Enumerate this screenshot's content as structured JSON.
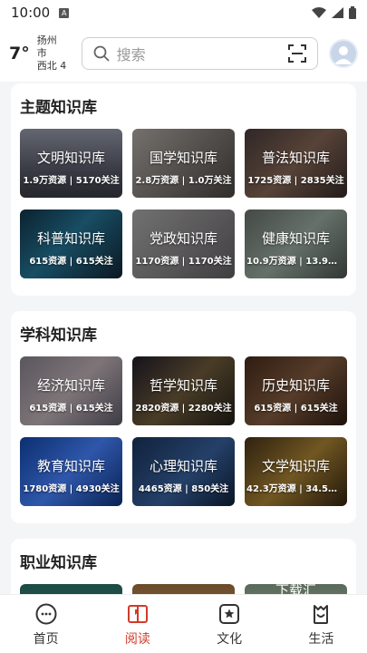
{
  "status": {
    "time": "10:00",
    "notif_letter": "A"
  },
  "weather": {
    "temp": "7°",
    "city": "扬州市",
    "wind": "西北 4"
  },
  "search": {
    "placeholder": "搜索"
  },
  "sections": [
    {
      "title": "主题知识库",
      "tiles": [
        {
          "name": "文明知识库",
          "stats": "1.9万资源 | 5170关注"
        },
        {
          "name": "国学知识库",
          "stats": "2.8万资源 | 1.0万关注"
        },
        {
          "name": "普法知识库",
          "stats": "1725资源 | 2835关注"
        },
        {
          "name": "科普知识库",
          "stats": "615资源 | 615关注"
        },
        {
          "name": "党政知识库",
          "stats": "1170资源 | 1170关注"
        },
        {
          "name": "健康知识库",
          "stats": "10.9万资源 | 13.9万..."
        }
      ]
    },
    {
      "title": "学科知识库",
      "tiles": [
        {
          "name": "经济知识库",
          "stats": "615资源 | 615关注"
        },
        {
          "name": "哲学知识库",
          "stats": "2820资源 | 2280关注"
        },
        {
          "name": "历史知识库",
          "stats": "615资源 | 615关注"
        },
        {
          "name": "教育知识库",
          "stats": "1780资源 | 4930关注"
        },
        {
          "name": "心理知识库",
          "stats": "4465资源 | 850关注"
        },
        {
          "name": "文学知识库",
          "stats": "42.3万资源 | 34.5万..."
        }
      ]
    },
    {
      "title": "职业知识库",
      "peek_text": "下载汇"
    }
  ],
  "tabs": [
    {
      "label": "首页",
      "icon": "home-chat-icon"
    },
    {
      "label": "阅读",
      "icon": "book-icon"
    },
    {
      "label": "文化",
      "icon": "star-frame-icon"
    },
    {
      "label": "生活",
      "icon": "smile-bag-icon"
    }
  ],
  "colors": {
    "accent": "#d23a2a",
    "background": "#f4f5f7"
  }
}
